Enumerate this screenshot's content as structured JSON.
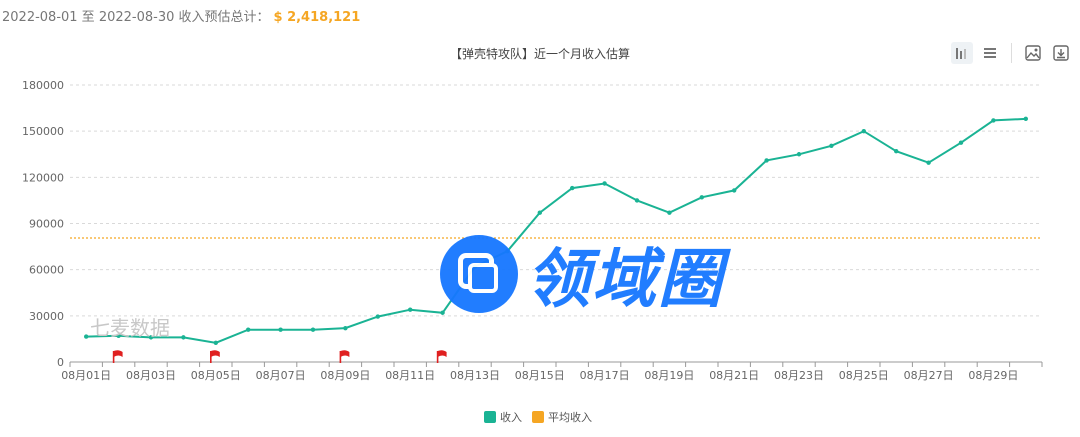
{
  "summary": {
    "range_label": "2022-08-01 至 2022-08-30 收入预估总计：",
    "total": "$ 2,418,121"
  },
  "colors": {
    "series": "#1ab394",
    "average": "#f5a623",
    "flag": "#e02020",
    "watermark": "#1677ff"
  },
  "toolbar": {
    "icons": [
      "bar-chart-toggle-icon",
      "list-toggle-icon",
      "save-image-icon",
      "download-icon"
    ]
  },
  "watermark": {
    "brand": "领域圈",
    "source": "七麦数据"
  },
  "chart_data": {
    "type": "line",
    "title": "【弹壳特攻队】近一个月收入估算",
    "x": [
      "08月01日",
      "08月02日",
      "08月03日",
      "08月04日",
      "08月05日",
      "08月06日",
      "08月07日",
      "08月08日",
      "08月09日",
      "08月10日",
      "08月11日",
      "08月12日",
      "08月13日",
      "08月14日",
      "08月15日",
      "08月16日",
      "08月17日",
      "08月18日",
      "08月19日",
      "08月20日",
      "08月21日",
      "08月22日",
      "08月23日",
      "08月24日",
      "08月25日",
      "08月26日",
      "08月27日",
      "08月28日",
      "08月29日",
      "08月30日"
    ],
    "x_tick_labels": [
      "08月01日",
      "08月03日",
      "08月05日",
      "08月07日",
      "08月09日",
      "08月11日",
      "08月13日",
      "08月15日",
      "08月17日",
      "08月19日",
      "08月21日",
      "08月23日",
      "08月25日",
      "08月27日",
      "08月29日"
    ],
    "series": [
      {
        "name": "收入",
        "values": [
          16500,
          17000,
          16000,
          16000,
          12500,
          21000,
          21000,
          21000,
          22000,
          29500,
          34000,
          32000,
          62000,
          72000,
          97000,
          113000,
          116000,
          105000,
          97000,
          107000,
          111500,
          131000,
          135000,
          140500,
          150000,
          137000,
          129500,
          142500,
          157000,
          158000
        ]
      }
    ],
    "average": {
      "name": "平均收入",
      "value": 80600
    },
    "flags_at": [
      "08月02日",
      "08月05日",
      "08月09日",
      "08月12日"
    ],
    "y_ticks": [
      0,
      30000,
      60000,
      90000,
      120000,
      150000,
      180000
    ],
    "ylim": [
      0,
      180000
    ],
    "grid": true,
    "legend": {
      "position": "bottom",
      "items": [
        "收入",
        "平均收入"
      ]
    }
  }
}
